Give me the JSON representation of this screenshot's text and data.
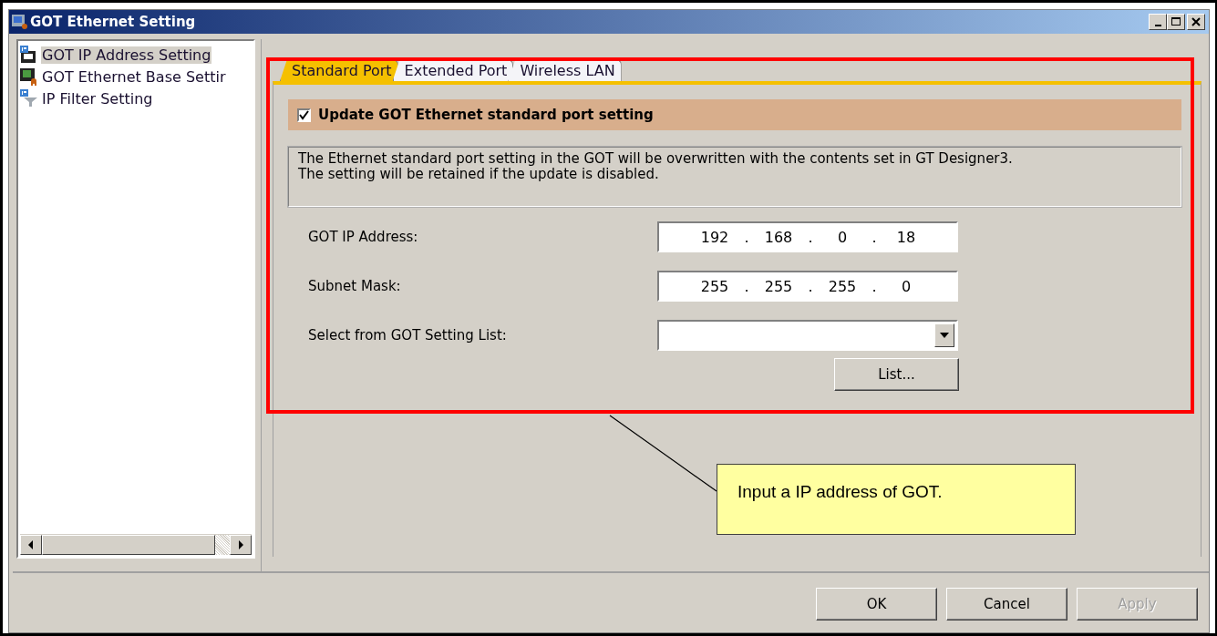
{
  "window": {
    "title": "GOT Ethernet Setting"
  },
  "tree": {
    "items": [
      {
        "label": "GOT IP Address Setting",
        "kind": "ip-disk",
        "selected": true
      },
      {
        "label": "GOT Ethernet Base Settir",
        "kind": "base",
        "selected": false
      },
      {
        "label": "IP Filter Setting",
        "kind": "filter",
        "selected": false
      }
    ]
  },
  "tabs": [
    {
      "label": "Standard Port",
      "selected": true
    },
    {
      "label": "Extended Port",
      "selected": false
    },
    {
      "label": "Wireless LAN",
      "selected": false
    }
  ],
  "update_checkbox": {
    "label": "Update GOT Ethernet standard port setting",
    "checked": true
  },
  "description": [
    "The Ethernet standard port setting in the GOT will be overwritten with the contents set in GT Designer3.",
    "The setting will be retained if the update is disabled."
  ],
  "fields": [
    {
      "label": "GOT IP Address:",
      "kind": "ip",
      "octets": [
        "192",
        "168",
        "0",
        "18"
      ],
      "separators": [
        ".",
        ".",
        "."
      ]
    },
    {
      "label": "Subnet Mask:",
      "kind": "ip",
      "octets": [
        "255",
        "255",
        "255",
        "0"
      ],
      "separators": [
        ".",
        ".",
        "."
      ]
    },
    {
      "label": "Select from GOT Setting List:",
      "kind": "dropdown"
    }
  ],
  "list_button": "List...",
  "buttons": [
    {
      "label": "OK",
      "disabled": false
    },
    {
      "label": "Cancel",
      "disabled": false
    },
    {
      "label": "Apply",
      "disabled": true
    }
  ],
  "annotation": {
    "text": "Input a IP address of GOT."
  }
}
